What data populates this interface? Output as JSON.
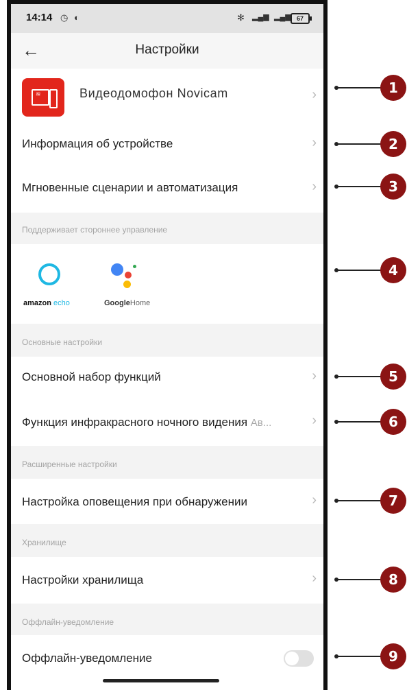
{
  "status_bar": {
    "time": "14:14",
    "battery": "67"
  },
  "header": {
    "title": "Настройки"
  },
  "device": {
    "name": "Видеодомофон Novicam"
  },
  "rows": {
    "device_info": "Информация об устройстве",
    "scenes": "Мгновенные сценарии и автоматизация",
    "basic_functions": "Основной набор функций",
    "ir_night": "Функция инфракрасного ночного видения",
    "ir_night_value": "Ав...",
    "detection_alert": "Настройка оповещения при обнаружении",
    "storage": "Настройки хранилища",
    "offline": "Оффлайн-уведомление"
  },
  "sections": {
    "third_party": "Поддерживает стороннее управление",
    "basic": "Основные настройки",
    "advanced": "Расширенные настройки",
    "storage": "Хранилище",
    "offline": "Оффлайн-уведомление"
  },
  "third_party": {
    "amazon_a": "amazon",
    "amazon_b": "echo",
    "google_a": "Google",
    "google_b": "Home"
  },
  "offline_toggle_on": false,
  "callouts": [
    "1",
    "2",
    "3",
    "4",
    "5",
    "6",
    "7",
    "8",
    "9"
  ],
  "colors": {
    "accent_red": "#e2261c",
    "callout": "#8b1414",
    "echo_blue": "#1fb8e3"
  }
}
